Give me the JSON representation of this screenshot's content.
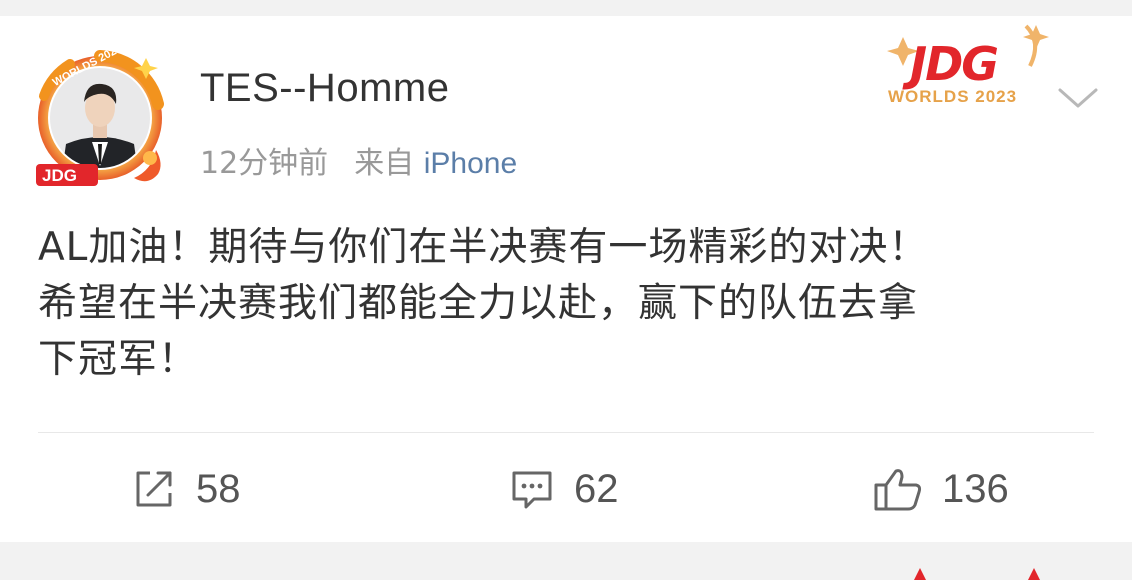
{
  "post": {
    "username": "TES--Homme",
    "time": "12分钟前",
    "source_prefix": "来自",
    "device": "iPhone",
    "avatar_frame_text": "WORLDS 2023",
    "avatar_badge_text": "JDG",
    "header_badge": {
      "logo": "JDG",
      "subtitle": "WORLDS 2023"
    },
    "content_lines": [
      "AL加油！期待与你们在半决赛有一场精彩的对决！",
      "希望在半决赛我们都能全力以赴，赢下的队伍去拿",
      "下冠军！"
    ]
  },
  "actions": {
    "repost_icon": "share-edit-icon",
    "repost_count": "58",
    "comment_icon": "comment-icon",
    "comment_count": "62",
    "like_icon": "thumbs-up-icon",
    "like_count": "136"
  },
  "colors": {
    "accent_link": "#5b7ea8",
    "badge_red": "#e2262b",
    "badge_gold": "#e6a24a",
    "text_primary": "#333333",
    "text_secondary": "#999999"
  }
}
